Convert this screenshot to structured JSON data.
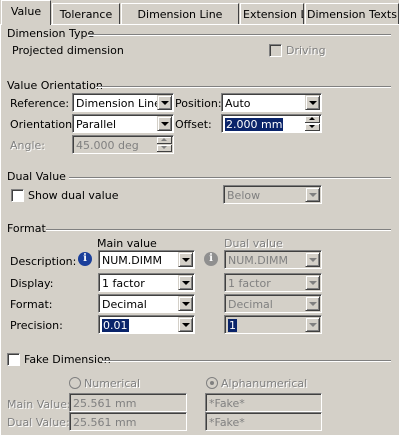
{
  "tabs": [
    {
      "label": "Value",
      "active": true
    },
    {
      "label": "Tolerance"
    },
    {
      "label": "Dimension Line"
    },
    {
      "label": "Extension Line"
    },
    {
      "label": "Dimension Texts"
    }
  ],
  "dimension_type": {
    "heading": "Dimension Type",
    "type_text": "Projected dimension",
    "driving_label": "Driving"
  },
  "value_orientation": {
    "heading": "Value Orientation",
    "reference_label": "Reference:",
    "reference_value": "Dimension Line",
    "position_label": "Position:",
    "position_value": "Auto",
    "orientation_label": "Orientation:",
    "orientation_value": "Parallel",
    "offset_label": "Offset:",
    "offset_value": "2.000 mm",
    "angle_label": "Angle:",
    "angle_value": "45.000 deg"
  },
  "dual_value": {
    "heading": "Dual Value",
    "show_label": "Show dual value",
    "mode_value": "Below"
  },
  "format": {
    "heading": "Format",
    "main_header": "Main value",
    "dual_header": "Dual value",
    "description_label": "Description:",
    "display_label": "Display:",
    "format_label": "Format:",
    "precision_label": "Precision:",
    "main": {
      "description": "NUM.DIMM",
      "display": "1 factor",
      "format": "Decimal",
      "precision": "0.01"
    },
    "dual": {
      "description": "NUM.DIMM",
      "display": "1 factor",
      "format": "Decimal",
      "precision": "1"
    }
  },
  "fake_dimension": {
    "heading": "Fake Dimension",
    "numerical_label": "Numerical",
    "alphanumerical_label": "Alphanumerical",
    "main_value_label": "Main Value:",
    "dual_value_label": "Dual Value:",
    "numerical_main": "25.561 mm",
    "numerical_dual": "25.561 mm",
    "alpha_main": "*Fake*",
    "alpha_dual": "*Fake*"
  },
  "icons": {
    "info": "info-icon",
    "dropdown": "chevron-down-icon",
    "spinner": "spinner-icon"
  }
}
